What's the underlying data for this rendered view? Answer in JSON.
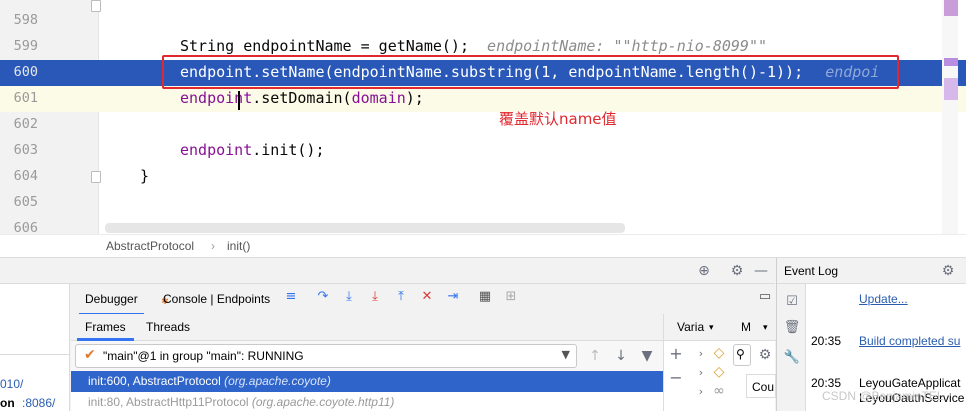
{
  "editor": {
    "lines": [
      {
        "num": "598",
        "code": ""
      },
      {
        "num": "599",
        "code_type": "String endpointName = getName();",
        "hint": "endpointName: \"\"http-nio-8099\"\""
      },
      {
        "num": "600",
        "code_a": "endpoint.setName(endpointName.substring(1, endpointName.length()-1));",
        "hint": "endpoi"
      },
      {
        "num": "601",
        "code_obj": "endpoint",
        "code_rest": ".setDomain(",
        "code_arg": "domain",
        "code_end": ");"
      },
      {
        "num": "602",
        "code": ""
      },
      {
        "num": "603",
        "code_obj": "endpoint",
        "code_rest": ".init();"
      },
      {
        "num": "604",
        "code": "}"
      },
      {
        "num": "605",
        "code": ""
      },
      {
        "num": "606",
        "code": ""
      }
    ],
    "annotation": "覆盖默认name值"
  },
  "breadcrumb": {
    "class_name": "AbstractProtocol",
    "method": "init()"
  },
  "debugger": {
    "tabs": [
      "Debugger",
      "Console | Endpoints"
    ],
    "active_tab": "Debugger",
    "sub_tabs": [
      "Frames",
      "Threads"
    ],
    "active_sub_tab": "Frames",
    "thread_selector": "\"main\"@1 in group \"main\": RUNNING",
    "frames": [
      {
        "method": "init:600, AbstractProtocol",
        "pkg": "(org.apache.coyote)"
      },
      {
        "method": "init:80, AbstractHttp11Protocol",
        "pkg": "(org.apache.coyote.http11)"
      }
    ],
    "vars_header": "Varia",
    "memory_header": "M",
    "count_label": "Cou",
    "left_strip": [
      "010/",
      "on",
      ":8086/"
    ]
  },
  "event_log": {
    "title": "Event Log",
    "entries": [
      {
        "time": "",
        "text": "Update...",
        "link": true
      },
      {
        "time": "20:35",
        "text": "Build completed su",
        "link": true
      },
      {
        "time": "20:35",
        "text": "LeyouGateApplicat",
        "link": false
      },
      {
        "time": "",
        "text": "LeyouOauthService",
        "link": false
      }
    ]
  },
  "watermark": "CSDN @BenjaminTEL",
  "colors": {
    "exec_line": "#2a58b8",
    "annotation": "#e0282e",
    "accent": "#3574f0",
    "selected_frame": "#2f65ca"
  }
}
